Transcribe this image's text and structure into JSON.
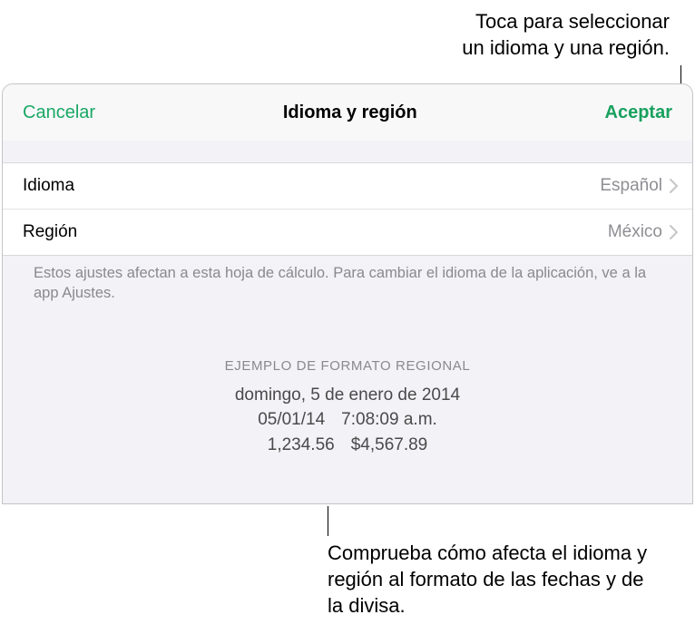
{
  "annotations": {
    "top": "Toca para seleccionar\nun idioma y una región.",
    "bottom": "Comprueba cómo afecta el idioma y región al formato de las fechas y de la divisa."
  },
  "header": {
    "cancel": "Cancelar",
    "title": "Idioma y región",
    "accept": "Aceptar"
  },
  "rows": {
    "language": {
      "label": "Idioma",
      "value": "Español"
    },
    "region": {
      "label": "Región",
      "value": "México"
    }
  },
  "footer_note": "Estos ajustes afectan a esta hoja de cálculo. Para cambiar el idioma de la aplicación, ve a la app Ajustes.",
  "example": {
    "title": "EJEMPLO DE FORMATO REGIONAL",
    "long_date": "domingo, 5 de enero de 2014",
    "short_date": "05/01/14",
    "time": "7:08:09 a.m.",
    "number": "1,234.56",
    "currency": "$4,567.89"
  }
}
